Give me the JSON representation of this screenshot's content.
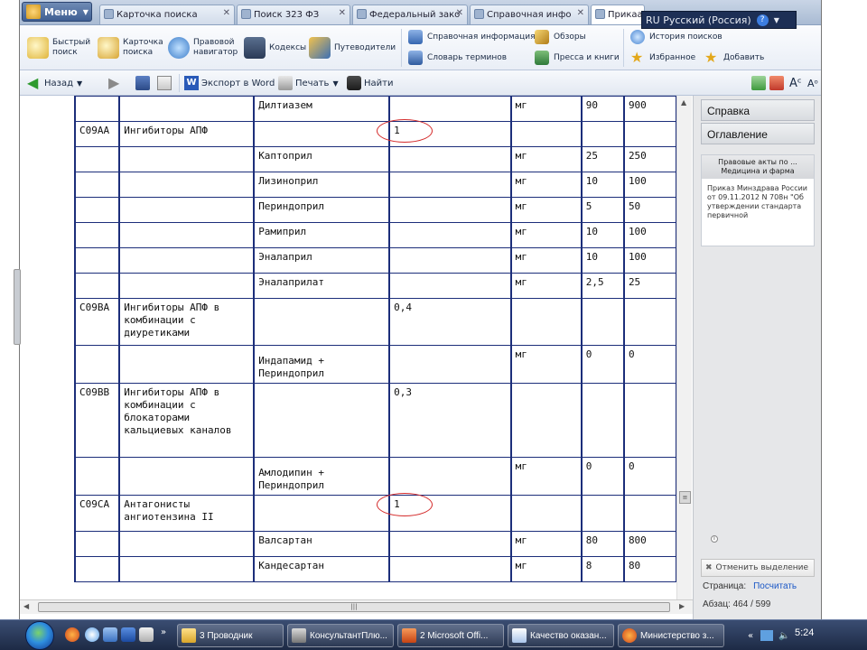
{
  "window": {
    "menu_label": "Меню",
    "tabs": [
      {
        "label": "Карточка поиска"
      },
      {
        "label": "Поиск 323 ФЗ"
      },
      {
        "label": "Федеральный зако"
      },
      {
        "label": "Справочная инфо"
      },
      {
        "label": "Прикаа"
      }
    ],
    "language": "RU Русский (Россия)",
    "help_label": "?"
  },
  "ribbon": {
    "quick_search": "Быстрый поиск",
    "search_card": "Карточка поиска",
    "legal_navigator": "Правовой навигатор",
    "codes": "Кодексы",
    "guides": "Путеводители",
    "reference_info": "Справочная информация",
    "reviews": "Обзоры",
    "search_history": "История поисков",
    "glossary": "Словарь терминов",
    "press_books": "Пресса и книги",
    "favorites": "Избранное",
    "add": "Добавить"
  },
  "toolbar": {
    "back": "Назад",
    "export_word": "Экспорт в Word",
    "print": "Печать",
    "find": "Найти"
  },
  "table": {
    "rows": [
      {
        "code": "",
        "group": "",
        "drug": "Дилтиазем",
        "freq": "",
        "unit": "мг",
        "ddd": "90",
        "ekd": "900",
        "h": 28
      },
      {
        "code": "C09AA",
        "group": "Ингибиторы АПФ",
        "drug": "",
        "freq": "1",
        "unit": "",
        "ddd": "",
        "ekd": "",
        "h": 28
      },
      {
        "code": "",
        "group": "",
        "drug": "Каптоприл",
        "freq": "",
        "unit": "мг",
        "ddd": "25",
        "ekd": "250",
        "h": 28
      },
      {
        "code": "",
        "group": "",
        "drug": "Лизиноприл",
        "freq": "",
        "unit": "мг",
        "ddd": "10",
        "ekd": "100",
        "h": 28
      },
      {
        "code": "",
        "group": "",
        "drug": "Периндоприл",
        "freq": "",
        "unit": "мг",
        "ddd": "5",
        "ekd": "50",
        "h": 28
      },
      {
        "code": "",
        "group": "",
        "drug": "Рамиприл",
        "freq": "",
        "unit": "мг",
        "ddd": "10",
        "ekd": "100",
        "h": 28
      },
      {
        "code": "",
        "group": "",
        "drug": "Эналаприл",
        "freq": "",
        "unit": "мг",
        "ddd": "10",
        "ekd": "100",
        "h": 28
      },
      {
        "code": "",
        "group": "",
        "drug": "Эналаприлат",
        "freq": "",
        "unit": "мг",
        "ddd": "2,5",
        "ekd": "25",
        "h": 28
      },
      {
        "code": "C09BA",
        "group": "Ингибиторы АПФ в комбинации с диуретиками",
        "drug": "",
        "freq": "0,4",
        "unit": "",
        "ddd": "",
        "ekd": "",
        "h": 52
      },
      {
        "code": "",
        "group": "",
        "drug": "Индапамид + Периндоприл",
        "freq": "",
        "unit": "мг",
        "ddd": "0",
        "ekd": "0",
        "h": 42
      },
      {
        "code": "C09BB",
        "group": "Ингибиторы АПФ в комбинации с блокаторами кальциевых каналов",
        "drug": "",
        "freq": "0,3",
        "unit": "",
        "ddd": "",
        "ekd": "",
        "h": 82
      },
      {
        "code": "",
        "group": "",
        "drug": "Амлодипин + Периндоприл",
        "freq": "",
        "unit": "мг",
        "ddd": "0",
        "ekd": "0",
        "h": 42
      },
      {
        "code": "C09CA",
        "group": "Антагонисты ангиотензина II",
        "drug": "",
        "freq": "1",
        "unit": "",
        "ddd": "",
        "ekd": "",
        "h": 40
      },
      {
        "code": "",
        "group": "",
        "drug": "Валсартан",
        "freq": "",
        "unit": "мг",
        "ddd": "80",
        "ekd": "800",
        "h": 28
      },
      {
        "code": "",
        "group": "",
        "drug": "Кандесартан",
        "freq": "",
        "unit": "мг",
        "ddd": "8",
        "ekd": "80",
        "h": 28
      }
    ]
  },
  "right_panel": {
    "help": "Справка",
    "contents": "Оглавление",
    "box_header_1": "Правовые акты по ...",
    "box_header_2": "Медицина и фарма",
    "box_body": "Приказ Минздрава России от 09.11.2012 N 708н \"Об утверждении стандарта первичной",
    "unselect": "Отменить выделение",
    "page_label": "Страница:",
    "page_link": "Посчитать",
    "paragraph": "Абзац:  464 / 599"
  },
  "taskbar": {
    "tasks": [
      {
        "label": "3 Проводник"
      },
      {
        "label": "КонсультантПлю..."
      },
      {
        "label": "2 Microsoft Offi..."
      },
      {
        "label": "Качество оказан..."
      },
      {
        "label": "Министерство з..."
      }
    ],
    "clock": "5:24"
  },
  "colors": {
    "table_border": "#1c2e7a",
    "annotation_circle": "#d42a2a",
    "taskbar": "#1d2a45"
  }
}
